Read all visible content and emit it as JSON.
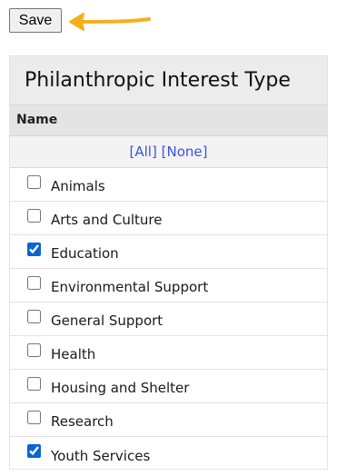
{
  "toolbar": {
    "save_label": "Save"
  },
  "annotation": {
    "arrow_color": "#f2b01e",
    "arrow_icon": "arrow-left-icon"
  },
  "panel": {
    "title": "Philanthropic Interest Type",
    "column_header": "Name",
    "select_all_label": "[All]",
    "select_none_label": "[None]",
    "items": [
      {
        "label": "Animals",
        "checked": false
      },
      {
        "label": "Arts and Culture",
        "checked": false
      },
      {
        "label": "Education",
        "checked": true
      },
      {
        "label": "Environmental Support",
        "checked": false
      },
      {
        "label": "General Support",
        "checked": false
      },
      {
        "label": "Health",
        "checked": false
      },
      {
        "label": "Housing and Shelter",
        "checked": false
      },
      {
        "label": "Research",
        "checked": false
      },
      {
        "label": "Youth Services",
        "checked": true
      }
    ]
  },
  "colors": {
    "link": "#3d55d9",
    "checkbox_accent": "#0b63d6",
    "title_bg": "#ececec",
    "header_bg": "#e4e4e4"
  }
}
